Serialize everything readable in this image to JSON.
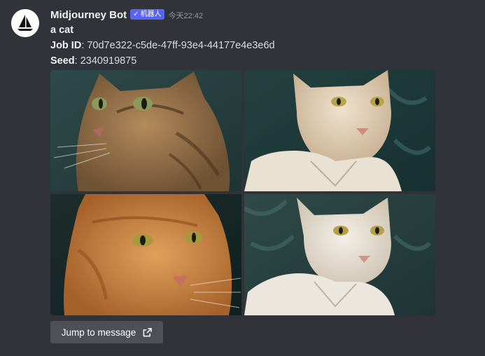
{
  "message": {
    "author": "Midjourney Bot",
    "bot_tag": {
      "check": "✓",
      "label": "机器人"
    },
    "timestamp": "今天22:42",
    "prompt": "a cat",
    "job_id_label": "Job ID",
    "job_id_value": ": 70d7e322-c5de-47ff-93e4-44177e4e3e6d",
    "seed_label": "Seed",
    "seed_value": ": 2340919875"
  },
  "images": [
    {
      "subject": "tabby-cat",
      "fur": "#a07a4e"
    },
    {
      "subject": "white-cat-in-shirt",
      "fur": "#e6d3bc"
    },
    {
      "subject": "orange-cat",
      "fur": "#c9813d"
    },
    {
      "subject": "white-cat-in-shirt",
      "fur": "#ece6dc"
    }
  ],
  "jump_button": {
    "label": "Jump to message",
    "icon": "external-link-icon"
  },
  "colors": {
    "background": "#313338",
    "bot_tag": "#5865f2",
    "button": "#4e5058"
  }
}
